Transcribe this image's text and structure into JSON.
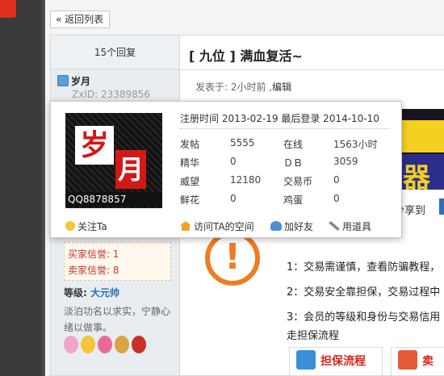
{
  "back_label": "« 返回列表",
  "reply_count": "15个回复",
  "author": {
    "name": "岁月",
    "zxid": "ZxID: 23389856",
    "buyer_credit": "买家信誉: 1",
    "seller_credit": "卖家信誉: 8",
    "level_label": "等级: ",
    "level_value": "大元帅",
    "signature": "淡泊功名以求实，宁静心绪以做事。"
  },
  "post": {
    "title": "[ 九位 ] 满血复活~",
    "meta": "发表于: 2小时前   ,",
    "edit_label": "编辑",
    "share_text": "分享到",
    "rules": [
      "1：交易需谨慎，查看防骗教程，",
      "2：交易安全靠担保，交易过程中",
      "3：会员的等级和身份与交易信用"
    ],
    "guarantee_line": "走担保流程",
    "flow_btn_1": "担保流程",
    "flow_btn_2": "卖"
  },
  "popup": {
    "avatar_chars": [
      "岁",
      "月"
    ],
    "avatar_qq": "QQ8878857",
    "reginfo": "注册时间 2013-02-19 最后登录 2014-10-10",
    "stats": [
      {
        "label": "发帖",
        "value": "5555"
      },
      {
        "label": "在线",
        "value": "1563小时"
      },
      {
        "label": "精华",
        "value": "0"
      },
      {
        "label": "ＤＢ",
        "value": "3059"
      },
      {
        "label": "威望",
        "value": "12180"
      },
      {
        "label": "交易币",
        "value": "0"
      },
      {
        "label": "鲜花",
        "value": "0"
      },
      {
        "label": "鸡蛋",
        "value": "0"
      }
    ],
    "follow_label": "关注Ta",
    "actions": {
      "visit": "访问TA的空间",
      "add_friend": "加好友",
      "use_item": "用道具"
    }
  },
  "colors": {
    "accent_orange": "#f07b22",
    "credit_red": "#c0392b",
    "level_blue": "#2a6fb0",
    "avatar_red": "#d31818"
  }
}
